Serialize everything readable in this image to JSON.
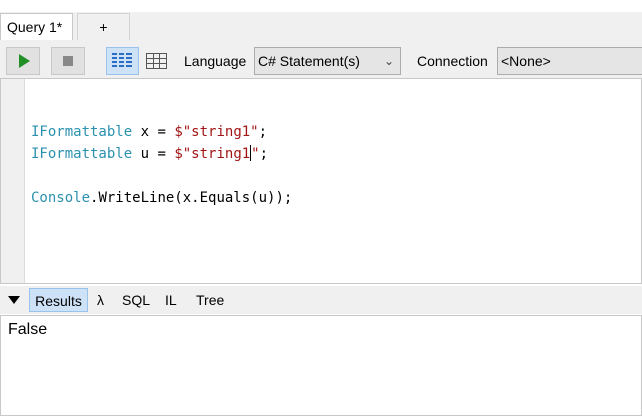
{
  "tabs": {
    "active_label": "Query 1*",
    "add_label": "+"
  },
  "toolbar": {
    "language_label": "Language",
    "language_value": "C# Statement(s)",
    "connection_label": "Connection",
    "connection_value": "<None>"
  },
  "editor": {
    "line1": {
      "type": "IFormattable",
      "rest": " x = ",
      "string": "$\"string1\"",
      "end": ";"
    },
    "line2": {
      "type": "IFormattable",
      "rest": " u = ",
      "string_before_caret": "$\"string1",
      "string_after_caret": "\"",
      "end": ";"
    },
    "line3": {
      "type": "Console",
      "rest": ".WriteLine(x.Equals(u));"
    }
  },
  "results_tabs": {
    "results": "Results",
    "lambda": "λ",
    "sql": "SQL",
    "il": "IL",
    "tree": "Tree"
  },
  "output": {
    "text": "False"
  },
  "colors": {
    "type_color": "#2b91af",
    "string_color": "#a31515",
    "run_green": "#1f8f26",
    "selected_blue": "#cde2f7"
  }
}
